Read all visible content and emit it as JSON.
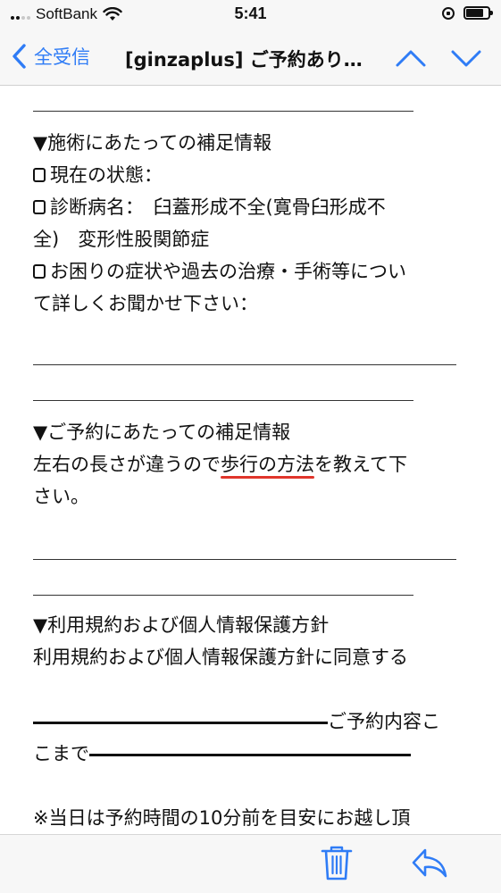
{
  "status_bar": {
    "carrier": "SoftBank",
    "time": "5:41",
    "battery_level": 0.8,
    "icons": [
      "signal-icon",
      "wifi-icon",
      "rotation-lock-icon",
      "battery-icon"
    ]
  },
  "nav": {
    "back_label": "全受信",
    "title": "[ginzaplus] ご予約あり…",
    "icons": [
      "chevron-left-icon",
      "chevron-up-icon",
      "chevron-down-icon"
    ]
  },
  "body": {
    "section1": {
      "heading": "▼施術にあたっての補足情報",
      "item1": "現在の状態：",
      "item2_line1": "診断病名：　臼蓋形成不全(寛骨臼形成不",
      "item2_line2": "全)　変形性股関節症",
      "item3_line1": "お困りの症状や過去の治療・手術等につい",
      "item3_line2": "て詳しくお聞かせ下さい："
    },
    "section2": {
      "heading": "▼ご予約にあたっての補足情報",
      "line1_before": "左右の長さが違うので",
      "line1_highlight": "歩行の方法",
      "line1_after": "を教えて下",
      "line2": "さい。"
    },
    "section3": {
      "heading": "▼利用規約および個人情報保護方針",
      "line1": "利用規約および個人情報保護方針に同意する"
    },
    "footer_marker": {
      "line1_text": "ご予約内容こ",
      "line2_text": "こまで"
    },
    "note": "※当日は予約時間の10分前を目安にお越し頂"
  },
  "toolbar": {
    "icons": [
      "trash-icon",
      "reply-icon"
    ]
  },
  "colors": {
    "accent": "#2f7cf6",
    "underline": "#e0352b",
    "bar_background": "#f7f7f7"
  }
}
